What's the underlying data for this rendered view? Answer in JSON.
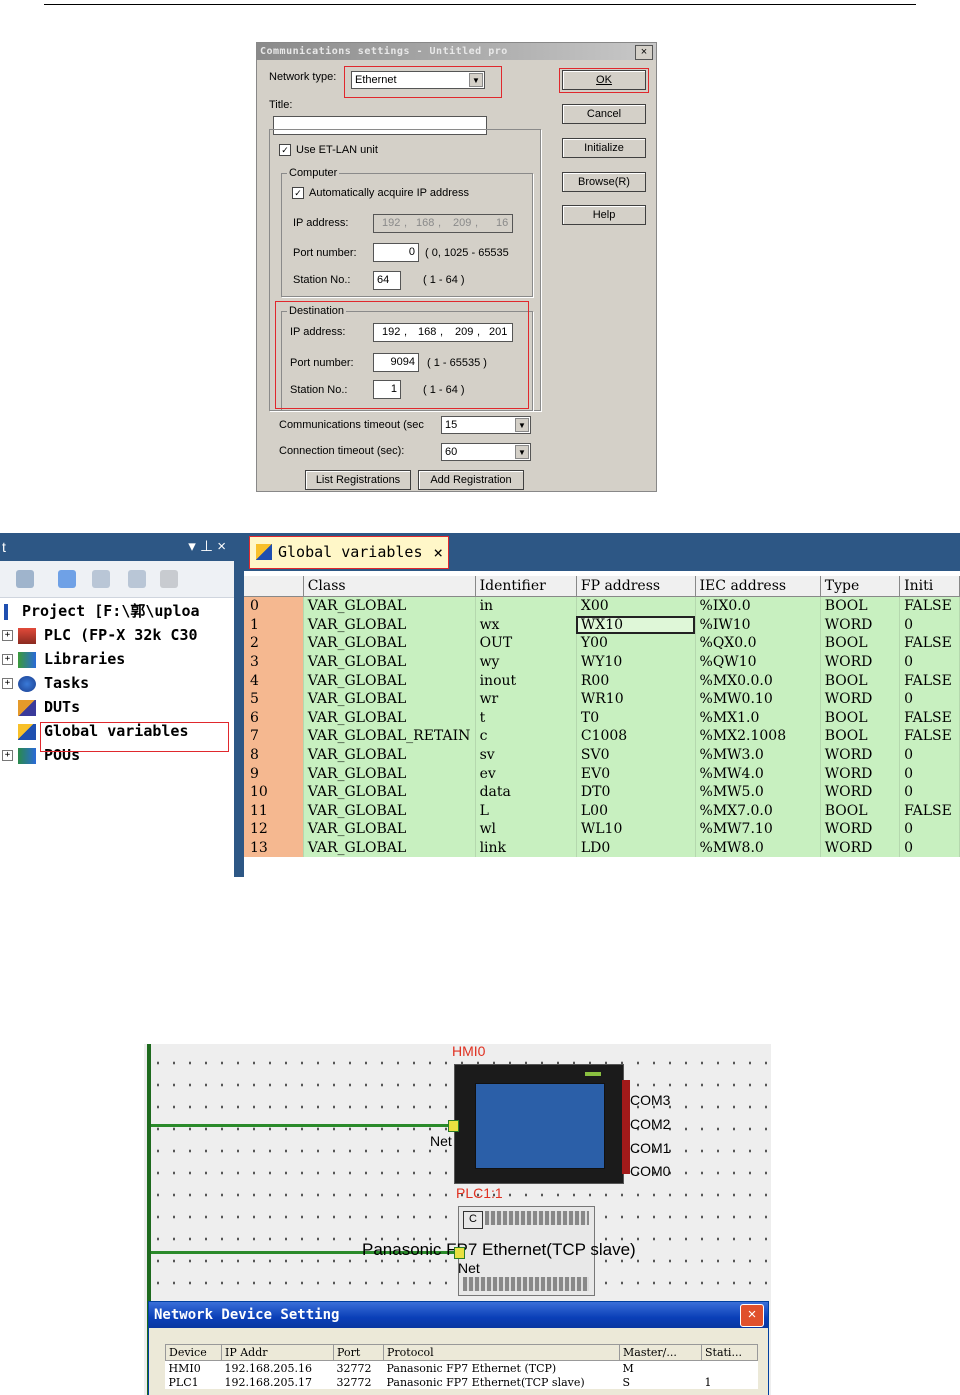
{
  "dialog": {
    "title": "Communications settings - Untitled pro",
    "close": "×",
    "network_type_label": "Network type:",
    "network_type_value": "Ethernet",
    "title_label": "Title:",
    "title_value": "",
    "use_et_lan": "Use ET-LAN unit",
    "computer_group": "Computer",
    "auto_ip": "Automatically acquire IP address",
    "ip_label": "IP address:",
    "computer_ip": [
      "192",
      "168",
      "209",
      "16"
    ],
    "port_label": "Port number:",
    "computer_port": "0",
    "computer_port_range": "( 0, 1025 - 65535",
    "station_label": "Station No.:",
    "computer_station": "64",
    "station_range": "( 1 - 64 )",
    "destination_group": "Destination",
    "dest_ip": [
      "192",
      "168",
      "209",
      "201"
    ],
    "dest_port": "9094",
    "dest_port_range": "( 1 - 65535 )",
    "dest_station": "1",
    "comm_timeout_label": "Communications timeout (sec",
    "comm_timeout_value": "15",
    "conn_timeout_label": "Connection timeout (sec):",
    "conn_timeout_value": "60",
    "buttons": {
      "ok": "OK",
      "cancel": "Cancel",
      "initialize": "Initialize",
      "browse": "Browse(R)",
      "help": "Help",
      "list_registrations": "List Registrations",
      "add_registration": "Add Registration"
    }
  },
  "project_panel": {
    "title": "t",
    "pin": "▾ ⊥ ×",
    "tree": [
      {
        "label": "Project [F:\\郭\\uploa",
        "icon": "project-icon"
      },
      {
        "label": "PLC (FP-X 32k C30",
        "icon": "plc-icon"
      },
      {
        "label": "Libraries",
        "icon": "libraries-icon"
      },
      {
        "label": "Tasks",
        "icon": "tasks-icon"
      },
      {
        "label": "DUTs",
        "icon": "duts-icon"
      },
      {
        "label": "Global variables",
        "icon": "global-variables-icon"
      },
      {
        "label": "POUs",
        "icon": "pous-icon"
      }
    ]
  },
  "global_vars": {
    "tab_label": "Global variables",
    "tab_close": "×",
    "columns": [
      "",
      "Class",
      "Identifier",
      "FP address",
      "IEC address",
      "Type",
      "Initi"
    ],
    "rows": [
      [
        "0",
        "VAR_GLOBAL",
        "in",
        "X00",
        "%IX0.0",
        "BOOL",
        "FALSE"
      ],
      [
        "1",
        "VAR_GLOBAL",
        "wx",
        "WX10",
        "%IW10",
        "WORD",
        "0"
      ],
      [
        "2",
        "VAR_GLOBAL",
        "OUT",
        "Y00",
        "%QX0.0",
        "BOOL",
        "FALSE"
      ],
      [
        "3",
        "VAR_GLOBAL",
        "wy",
        "WY10",
        "%QW10",
        "WORD",
        "0"
      ],
      [
        "4",
        "VAR_GLOBAL",
        "inout",
        "R00",
        "%MX0.0.0",
        "BOOL",
        "FALSE"
      ],
      [
        "5",
        "VAR_GLOBAL",
        "wr",
        "WR10",
        "%MW0.10",
        "WORD",
        "0"
      ],
      [
        "6",
        "VAR_GLOBAL",
        "t",
        "T0",
        "%MX1.0",
        "BOOL",
        "FALSE"
      ],
      [
        "7",
        "VAR_GLOBAL_RETAIN",
        "c",
        "C1008",
        "%MX2.1008",
        "BOOL",
        "FALSE"
      ],
      [
        "8",
        "VAR_GLOBAL",
        "sv",
        "SV0",
        "%MW3.0",
        "WORD",
        "0"
      ],
      [
        "9",
        "VAR_GLOBAL",
        "ev",
        "EV0",
        "%MW4.0",
        "WORD",
        "0"
      ],
      [
        "10",
        "VAR_GLOBAL",
        "data",
        "DT0",
        "%MW5.0",
        "WORD",
        "0"
      ],
      [
        "11",
        "VAR_GLOBAL",
        "L",
        "L00",
        "%MX7.0.0",
        "BOOL",
        "FALSE"
      ],
      [
        "12",
        "VAR_GLOBAL",
        "wl",
        "WL10",
        "%MW7.10",
        "WORD",
        "0"
      ],
      [
        "13",
        "VAR_GLOBAL",
        "link",
        "LD0",
        "%MW8.0",
        "WORD",
        "0"
      ]
    ]
  },
  "network": {
    "hmi_label": "HMI0",
    "net_label": "Net",
    "com_ports": [
      "COM3",
      "COM2",
      "COM1",
      "COM0"
    ],
    "plc_label": "PLC1:1",
    "plc_protocol": "Panasonic FP7 Ethernet(TCP slave)",
    "plc_net_label": "Net"
  },
  "network_device_setting": {
    "title": "Network Device Setting",
    "close": "×",
    "columns": [
      "Device",
      "IP Addr",
      "Port",
      "Protocol",
      "Master/...",
      "Stati..."
    ],
    "rows": [
      [
        "HMI0",
        "192.168.205.16",
        "32772",
        "Panasonic FP7 Ethernet (TCP)",
        "M",
        ""
      ],
      [
        "PLC1",
        "192.168.205.17",
        "32772",
        "Panasonic FP7 Ethernet(TCP slave)",
        "S",
        "1"
      ]
    ]
  }
}
